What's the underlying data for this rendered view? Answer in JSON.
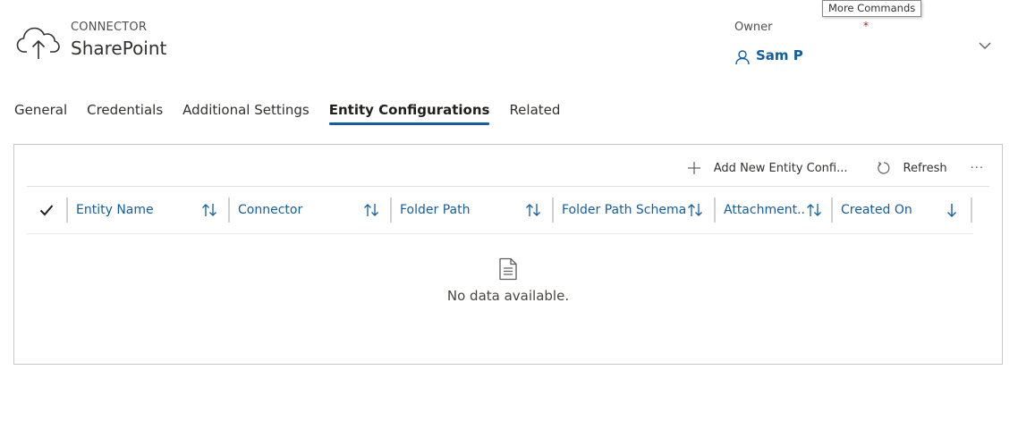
{
  "header": {
    "entity_type": "CONNECTOR",
    "title": "SharePoint",
    "entity_icon": "cloud-upload-icon",
    "owner": {
      "label": "Owner",
      "required_mark": "*",
      "value": "Sam P",
      "icon": "person-icon"
    },
    "expand_icon": "chevron-down-icon",
    "tooltip": "More Commands"
  },
  "tabs": [
    {
      "label": "General",
      "active": false
    },
    {
      "label": "Credentials",
      "active": false
    },
    {
      "label": "Additional Settings",
      "active": false
    },
    {
      "label": "Entity Configurations",
      "active": true
    },
    {
      "label": "Related",
      "active": false
    }
  ],
  "subgrid": {
    "commands": {
      "add_label": "Add New Entity Confi...",
      "add_icon": "plus-icon",
      "refresh_label": "Refresh",
      "refresh_icon": "refresh-icon",
      "more_label": "···"
    },
    "select_all_icon": "checkmark-icon",
    "columns": [
      {
        "label": "Entity Name",
        "sort_icon": "sort-both-icon"
      },
      {
        "label": "Connector",
        "sort_icon": "sort-both-icon"
      },
      {
        "label": "Folder Path",
        "sort_icon": "sort-both-icon"
      },
      {
        "label": "Folder Path Schema",
        "sort_icon": "sort-both-icon"
      },
      {
        "label": "Attachment...",
        "sort_icon": "sort-both-icon"
      },
      {
        "label": "Created On",
        "sort_icon": "sort-descending-icon"
      }
    ],
    "empty_icon": "document-icon",
    "empty_text": "No data available."
  },
  "colors": {
    "accent": "#115ea3",
    "text": "#323130",
    "required": "#a4262c",
    "border": "#c8c6c4"
  }
}
